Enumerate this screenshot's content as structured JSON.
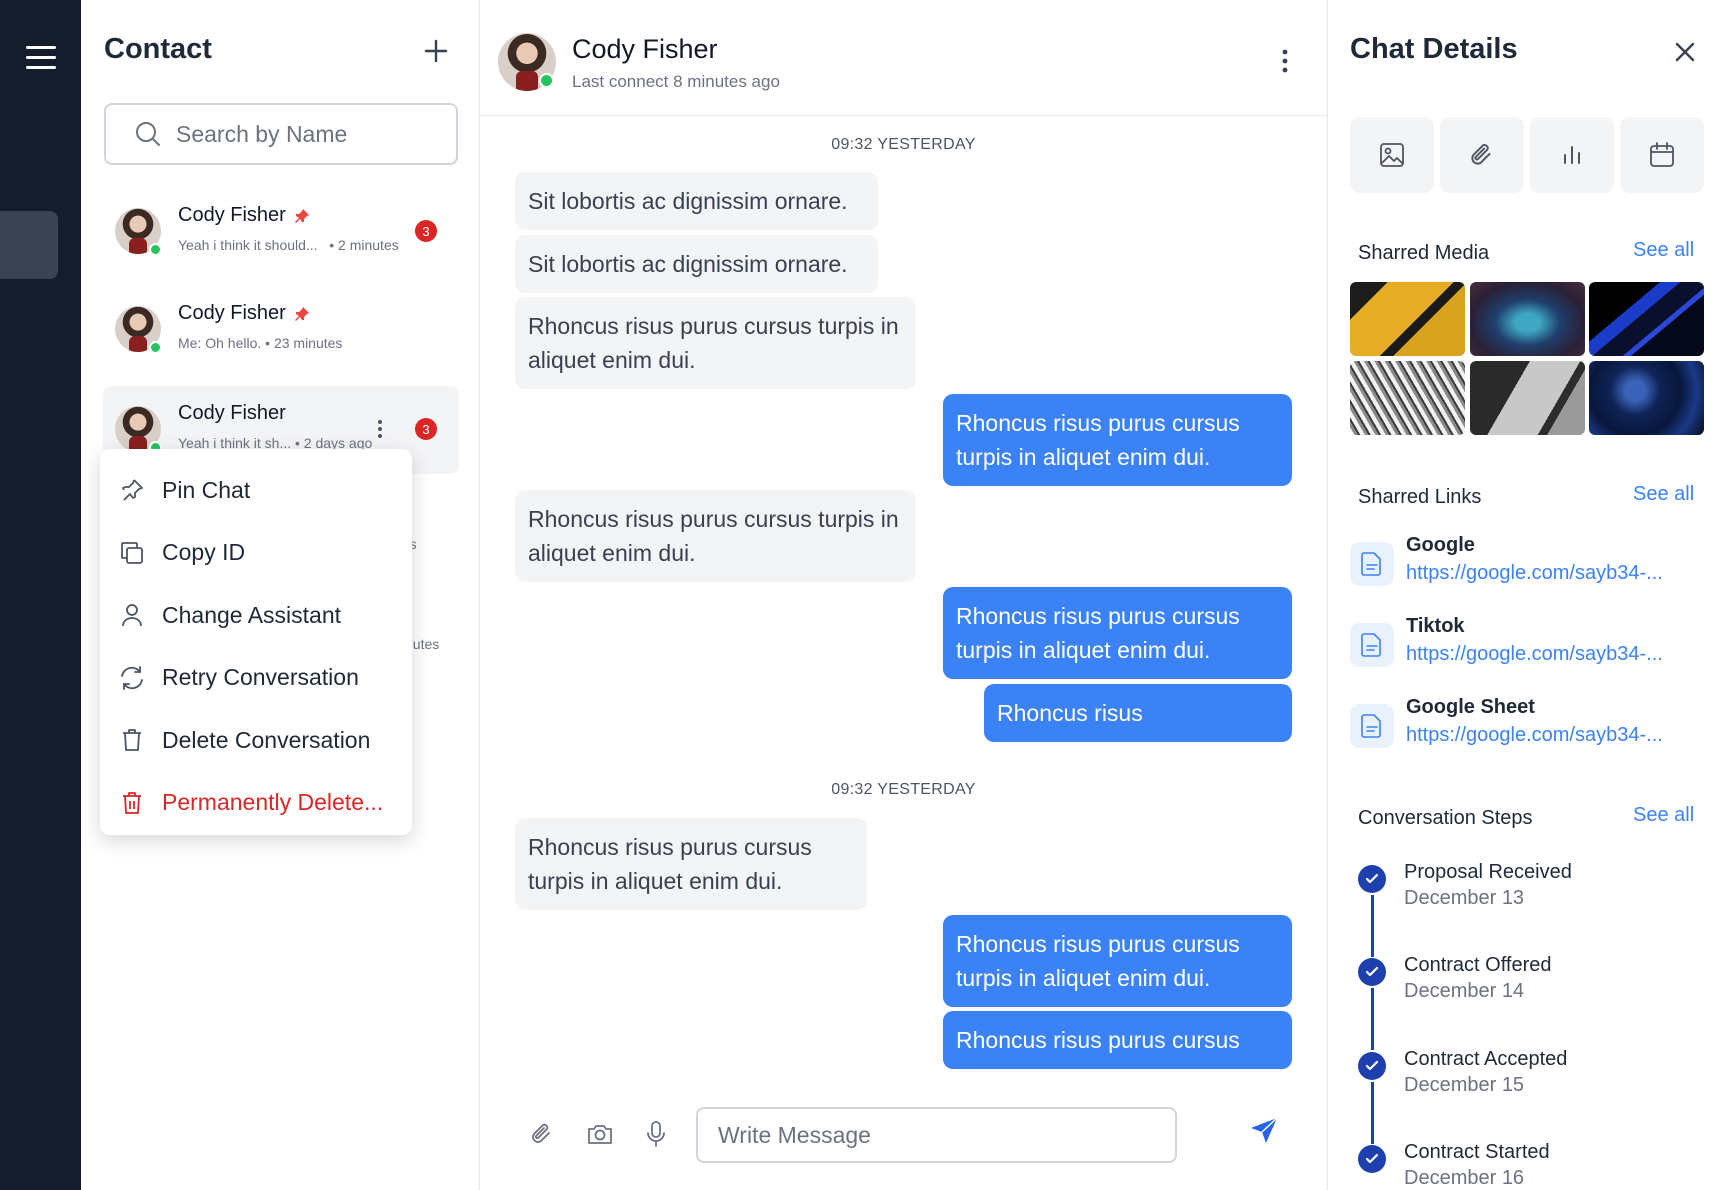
{
  "contacts": {
    "title": "Contact",
    "search_placeholder": "Search by Name",
    "items": [
      {
        "name": "Cody Fisher",
        "preview": "Yeah i think it should...",
        "time": "• 2 minutes",
        "badge": "3",
        "pinned": true
      },
      {
        "name": "Cody Fisher",
        "preview": "Me: Oh hello.",
        "time": "• 23 minutes",
        "badge": "",
        "pinned": true
      },
      {
        "name": "Cody Fisher",
        "preview": "Yeah i think it sh...",
        "time": "• 2 days ago",
        "badge": "3",
        "pinned": false
      }
    ],
    "hidden_fragments": [
      "rs",
      "nutes"
    ]
  },
  "context_menu": {
    "items": [
      {
        "label": "Pin Chat",
        "icon": "pin-icon"
      },
      {
        "label": "Copy ID",
        "icon": "copy-icon"
      },
      {
        "label": "Change Assistant",
        "icon": "user-icon"
      },
      {
        "label": "Retry Conversation",
        "icon": "refresh-icon"
      },
      {
        "label": "Delete Conversation",
        "icon": "trash-icon"
      },
      {
        "label": "Permanently Delete...",
        "icon": "trash-icon",
        "danger": true
      }
    ]
  },
  "chat": {
    "name": "Cody Fisher",
    "status": "Last connect 8 minutes ago",
    "stamps": [
      "09:32 YESTERDAY",
      "09:32 YESTERDAY"
    ],
    "messages": [
      {
        "dir": "in",
        "text": "Sit lobortis ac dignissim ornare."
      },
      {
        "dir": "in",
        "text": "Sit lobortis ac dignissim ornare."
      },
      {
        "dir": "in",
        "text": "Rhoncus risus purus cursus turpis in aliquet enim dui."
      },
      {
        "dir": "out",
        "text": "Rhoncus risus purus cursus turpis in aliquet enim dui."
      },
      {
        "dir": "in",
        "text": "Rhoncus risus purus cursus turpis in aliquet enim dui."
      },
      {
        "dir": "out",
        "text": "Rhoncus risus purus cursus turpis in aliquet enim dui."
      },
      {
        "dir": "out",
        "text": "Rhoncus risus"
      },
      {
        "dir": "in",
        "text": "Rhoncus risus purus cursus turpis in aliquet enim dui."
      },
      {
        "dir": "out",
        "text": "Rhoncus risus purus cursus turpis in aliquet enim dui."
      },
      {
        "dir": "out",
        "text": "Rhoncus risus purus cursus"
      }
    ],
    "composer_placeholder": "Write Message"
  },
  "details": {
    "title": "Chat Details",
    "tools": [
      "image-icon",
      "paperclip-icon",
      "chart-icon",
      "calendar-icon"
    ],
    "shared_media": {
      "title": "Sharred Media",
      "see_all": "See all"
    },
    "shared_links": {
      "title": "Sharred Links",
      "see_all": "See all",
      "items": [
        {
          "name": "Google",
          "url": "https://google.com/sayb34-..."
        },
        {
          "name": "Tiktok",
          "url": "https://google.com/sayb34-..."
        },
        {
          "name": "Google Sheet",
          "url": "https://google.com/sayb34-..."
        }
      ]
    },
    "steps": {
      "title": "Conversation Steps",
      "see_all": "See all",
      "items": [
        {
          "name": "Proposal Received",
          "date": "December 13"
        },
        {
          "name": "Contract Offered",
          "date": "December 14"
        },
        {
          "name": "Contract Accepted",
          "date": "December 15"
        },
        {
          "name": "Contract Started",
          "date": "December 16"
        }
      ]
    }
  },
  "colors": {
    "accent": "#3b82f6",
    "rail": "#151c2c",
    "danger": "#dc2626",
    "online": "#22c55e",
    "step": "#1e40af"
  }
}
